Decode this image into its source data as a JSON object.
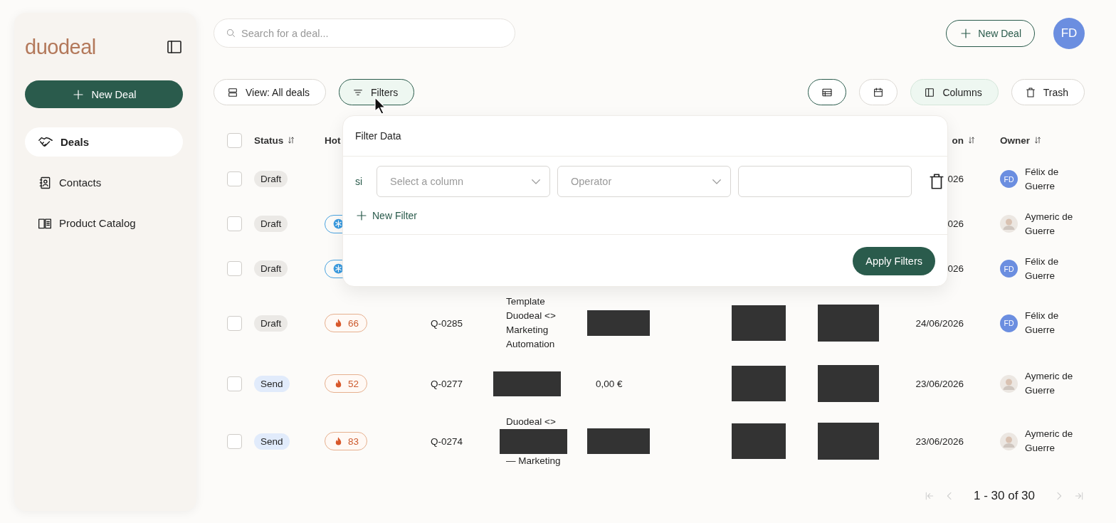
{
  "sidebar": {
    "logo": "duodeal",
    "new_deal_button": "New Deal",
    "items": [
      {
        "label": "Deals",
        "selected": true
      },
      {
        "label": "Contacts",
        "selected": false
      },
      {
        "label": "Product Catalog",
        "selected": false
      }
    ]
  },
  "topbar": {
    "search": {
      "placeholder": "Search for a deal..."
    },
    "new_deal_button": "New Deal",
    "avatar": "FD"
  },
  "toolbar": {
    "view_button": "View: All deals",
    "filters_button": {
      "label": "Filters",
      "active": true
    },
    "view_modes": [
      {
        "selected": true
      },
      {
        "selected": false
      }
    ],
    "columns_button": "Columns",
    "trash_button": "Trash"
  },
  "table": {
    "select_all_checked": false,
    "columns": [
      {
        "label": "Status",
        "sort_icon": true
      },
      {
        "label": "Hot",
        "sort_icon": false
      },
      {
        "label": "on",
        "sort_icon": true
      },
      {
        "label": "Owner",
        "sort_icon": true
      }
    ],
    "rows": [
      {
        "checked": false,
        "status": {
          "label": "Draft",
          "kind": "draft"
        },
        "hot": null,
        "date": "026",
        "owner": {
          "name": "Félix de Guerre",
          "kind": "initials",
          "initials": "FD"
        }
      },
      {
        "checked": false,
        "status": {
          "label": "Draft",
          "kind": "draft"
        },
        "hot": {
          "kind": "cold"
        },
        "date": "026",
        "owner": {
          "name": "Aymeric de Guerre",
          "kind": "photo"
        }
      },
      {
        "checked": false,
        "status": {
          "label": "Draft",
          "kind": "draft"
        },
        "hot": {
          "kind": "cold"
        },
        "date": "026",
        "owner": {
          "name": "Félix de Guerre",
          "kind": "initials",
          "initials": "FD"
        }
      },
      {
        "checked": false,
        "status": {
          "label": "Draft",
          "kind": "draft"
        },
        "hot": {
          "kind": "hot",
          "score": "66"
        },
        "quote": "Q-0285",
        "title_parts": [
          {
            "kind": "text",
            "text": "Template Duodeal <> Marketing Automation"
          }
        ],
        "amount": {
          "kind": "redacted"
        },
        "column_7": {
          "kind": "redacted"
        },
        "column_8": {
          "kind": "redacted"
        },
        "date": "24/06/2026",
        "owner": {
          "name": "Félix de Guerre",
          "kind": "initials",
          "initials": "FD"
        }
      },
      {
        "checked": false,
        "status": {
          "label": "Send",
          "kind": "sent"
        },
        "hot": {
          "kind": "hot",
          "score": "52"
        },
        "quote": "Q-0277",
        "title_parts": [
          {
            "kind": "redacted"
          }
        ],
        "amount": {
          "kind": "text",
          "text": "0,00 €"
        },
        "column_7": {
          "kind": "redacted"
        },
        "column_8": {
          "kind": "redacted"
        },
        "date": "23/06/2026",
        "owner": {
          "name": "Aymeric de Guerre",
          "kind": "photo"
        }
      },
      {
        "checked": false,
        "status": {
          "label": "Send",
          "kind": "sent"
        },
        "hot": {
          "kind": "hot",
          "score": "83"
        },
        "quote": "Q-0274",
        "title_parts": [
          {
            "kind": "text",
            "text": "Duodeal <>"
          },
          {
            "kind": "redacted"
          },
          {
            "kind": "text",
            "text": "— Marketing"
          }
        ],
        "amount": {
          "kind": "redacted"
        },
        "column_7": {
          "kind": "redacted"
        },
        "column_8": {
          "kind": "redacted"
        },
        "date": "23/06/2026",
        "owner": {
          "name": "Aymeric de Guerre",
          "kind": "photo"
        }
      }
    ]
  },
  "filter_popover": {
    "title": "Filter Data",
    "filters": [
      {
        "connector": "si",
        "column": {
          "placeholder": "Select a column"
        },
        "operator": {
          "placeholder": "Operator"
        }
      }
    ],
    "new_filter_button": "New Filter",
    "apply_button": "Apply Filters"
  },
  "pagination": {
    "range": "1 - 30 of 30",
    "first_disabled": true,
    "prev_disabled": true,
    "next_disabled": true,
    "last_disabled": true
  }
}
